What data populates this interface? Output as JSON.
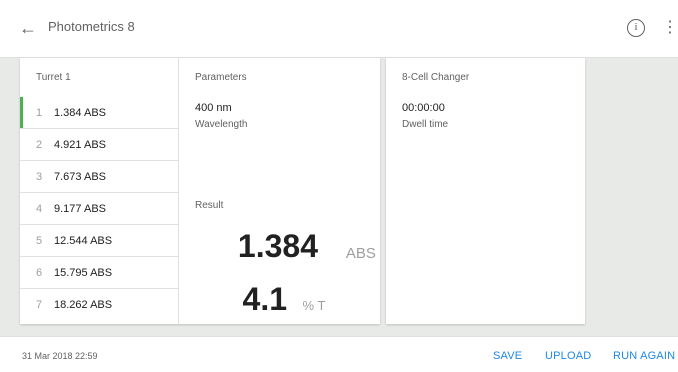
{
  "header": {
    "title": "Photometrics 8",
    "back_icon": "arrow-left-icon",
    "info_icon": "info-icon",
    "info_glyph": "i",
    "more_icon": "more-vert-icon"
  },
  "turret": {
    "title": "Turret 1",
    "items": [
      {
        "num": "1",
        "value": "1.384 ABS",
        "active": true
      },
      {
        "num": "2",
        "value": "4.921 ABS"
      },
      {
        "num": "3",
        "value": "7.673 ABS"
      },
      {
        "num": "4",
        "value": "9.177 ABS"
      },
      {
        "num": "5",
        "value": "12.544 ABS"
      },
      {
        "num": "6",
        "value": "15.795 ABS"
      },
      {
        "num": "7",
        "value": "18.262 ABS"
      }
    ]
  },
  "parameters": {
    "title": "Parameters",
    "wavelength_value": "400 nm",
    "wavelength_label": "Wavelength",
    "result_label": "Result",
    "abs_value": "1.384",
    "abs_unit": "ABS",
    "t_value": "4.1",
    "t_unit": "% T"
  },
  "cell_changer": {
    "title": "8-Cell Changer",
    "dwell_value": "00:00:00",
    "dwell_label": "Dwell time"
  },
  "footer": {
    "timestamp": "31 Mar 2018 22:59",
    "save_label": "SAVE",
    "upload_label": "UPLOAD",
    "run_again_label": "RUN AGAIN"
  },
  "colors": {
    "accent_blue": "#1e88e5",
    "active_green": "#4caf50"
  }
}
